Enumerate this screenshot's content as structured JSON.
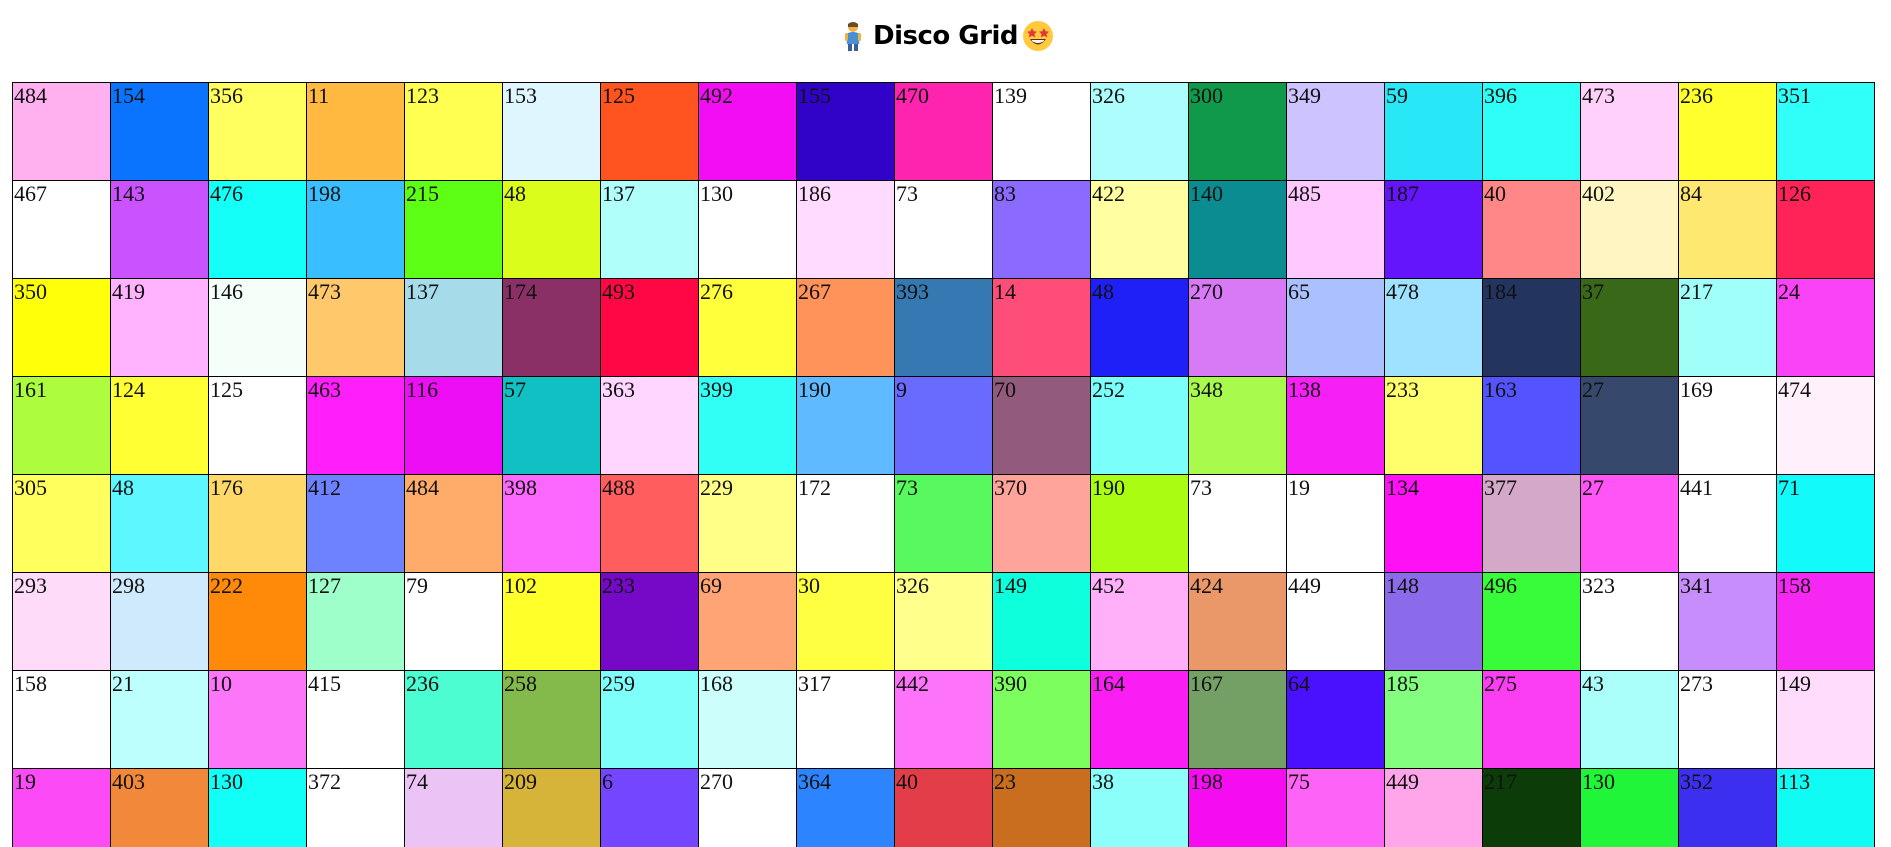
{
  "page": {
    "title": "Disco Grid",
    "left_icon": "dancing-person-icon",
    "right_icon": "star-struck-face-icon"
  },
  "grid": {
    "columns": 19,
    "rows": [
      [
        {
          "value": "484",
          "color": "#ffb0ee"
        },
        {
          "value": "154",
          "color": "#0a74ff"
        },
        {
          "value": "356",
          "color": "#ffff60"
        },
        {
          "value": "11",
          "color": "#ffb941"
        },
        {
          "value": "123",
          "color": "#ffff52"
        },
        {
          "value": "153",
          "color": "#e0f6ff"
        },
        {
          "value": "125",
          "color": "#ff5420"
        },
        {
          "value": "492",
          "color": "#f20df3"
        },
        {
          "value": "155",
          "color": "#3103c8"
        },
        {
          "value": "470",
          "color": "#ff24b0"
        },
        {
          "value": "139",
          "color": "#ffffff"
        },
        {
          "value": "326",
          "color": "#adfdfc"
        },
        {
          "value": "300",
          "color": "#10994a"
        },
        {
          "value": "349",
          "color": "#ccc3ff"
        },
        {
          "value": "59",
          "color": "#28e8f8"
        },
        {
          "value": "396",
          "color": "#2efff6"
        },
        {
          "value": "473",
          "color": "#ffd1fa"
        },
        {
          "value": "236",
          "color": "#ffff2e"
        },
        {
          "value": "351",
          "color": "#30fff9"
        }
      ],
      [
        {
          "value": "467",
          "color": "#ffffff"
        },
        {
          "value": "143",
          "color": "#cb53ff"
        },
        {
          "value": "476",
          "color": "#13fff8"
        },
        {
          "value": "198",
          "color": "#39beff"
        },
        {
          "value": "215",
          "color": "#5dff15"
        },
        {
          "value": "48",
          "color": "#dbfd1b"
        },
        {
          "value": "137",
          "color": "#b0fffa"
        },
        {
          "value": "130",
          "color": "#ffffff"
        },
        {
          "value": "186",
          "color": "#ffdbff"
        },
        {
          "value": "73",
          "color": "#ffffff"
        },
        {
          "value": "83",
          "color": "#8b6bff"
        },
        {
          "value": "422",
          "color": "#ffffa2"
        },
        {
          "value": "140",
          "color": "#0b8c91"
        },
        {
          "value": "485",
          "color": "#ffc8ff"
        },
        {
          "value": "187",
          "color": "#6515fb"
        },
        {
          "value": "40",
          "color": "#ff8787"
        },
        {
          "value": "402",
          "color": "#fff5c2"
        },
        {
          "value": "84",
          "color": "#ffe870"
        },
        {
          "value": "126",
          "color": "#ff2358"
        }
      ],
      [
        {
          "value": "350",
          "color": "#ffff0a"
        },
        {
          "value": "419",
          "color": "#ffb3ff"
        },
        {
          "value": "146",
          "color": "#f5fffa"
        },
        {
          "value": "473",
          "color": "#ffc96b"
        },
        {
          "value": "137",
          "color": "#a6dcea"
        },
        {
          "value": "174",
          "color": "#8b3066"
        },
        {
          "value": "493",
          "color": "#ff0745"
        },
        {
          "value": "276",
          "color": "#ffff3c"
        },
        {
          "value": "267",
          "color": "#ff9359"
        },
        {
          "value": "393",
          "color": "#3678b2"
        },
        {
          "value": "14",
          "color": "#ff4d79"
        },
        {
          "value": "48",
          "color": "#1f1ff7"
        },
        {
          "value": "270",
          "color": "#d879f5"
        },
        {
          "value": "65",
          "color": "#abc1ff"
        },
        {
          "value": "478",
          "color": "#9ee2ff"
        },
        {
          "value": "184",
          "color": "#23345e"
        },
        {
          "value": "37",
          "color": "#386818"
        },
        {
          "value": "217",
          "color": "#a1fffa"
        },
        {
          "value": "24",
          "color": "#fa42f7"
        }
      ],
      [
        {
          "value": "161",
          "color": "#adfc3d"
        },
        {
          "value": "124",
          "color": "#ffff33"
        },
        {
          "value": "125",
          "color": "#ffffff"
        },
        {
          "value": "463",
          "color": "#ff1ffb"
        },
        {
          "value": "116",
          "color": "#ee0ef6"
        },
        {
          "value": "57",
          "color": "#11c0c2"
        },
        {
          "value": "363",
          "color": "#ffd6ff"
        },
        {
          "value": "399",
          "color": "#31fff5"
        },
        {
          "value": "190",
          "color": "#5fbaff"
        },
        {
          "value": "9",
          "color": "#696bff"
        },
        {
          "value": "70",
          "color": "#925a7c"
        },
        {
          "value": "252",
          "color": "#7bfffa"
        },
        {
          "value": "348",
          "color": "#a8fa4d"
        },
        {
          "value": "138",
          "color": "#f61ff6"
        },
        {
          "value": "233",
          "color": "#ffff6b"
        },
        {
          "value": "163",
          "color": "#5454ff"
        },
        {
          "value": "27",
          "color": "#37486d"
        },
        {
          "value": "169",
          "color": "#ffffff"
        },
        {
          "value": "474",
          "color": "#fff0fb"
        }
      ],
      [
        {
          "value": "305",
          "color": "#ffff5e"
        },
        {
          "value": "48",
          "color": "#5cf7ff"
        },
        {
          "value": "176",
          "color": "#ffd86a"
        },
        {
          "value": "412",
          "color": "#6e82ff"
        },
        {
          "value": "484",
          "color": "#ffab6a"
        },
        {
          "value": "398",
          "color": "#fc67fe"
        },
        {
          "value": "488",
          "color": "#ff5d5e"
        },
        {
          "value": "229",
          "color": "#ffff88"
        },
        {
          "value": "172",
          "color": "#ffffff"
        },
        {
          "value": "73",
          "color": "#57f95f"
        },
        {
          "value": "370",
          "color": "#ffa49a"
        },
        {
          "value": "190",
          "color": "#aafd12"
        },
        {
          "value": "73",
          "color": "#ffffff"
        },
        {
          "value": "19",
          "color": "#ffffff"
        },
        {
          "value": "134",
          "color": "#ff10f5"
        },
        {
          "value": "377",
          "color": "#d3a8c8"
        },
        {
          "value": "27",
          "color": "#ff54f6"
        },
        {
          "value": "441",
          "color": "#ffffff"
        },
        {
          "value": "71",
          "color": "#12fbfa"
        }
      ],
      [
        {
          "value": "293",
          "color": "#ffdbfa"
        },
        {
          "value": "298",
          "color": "#cfe9fd"
        },
        {
          "value": "222",
          "color": "#ff8a0a"
        },
        {
          "value": "127",
          "color": "#9effcb"
        },
        {
          "value": "79",
          "color": "#ffffff"
        },
        {
          "value": "102",
          "color": "#ffff2a"
        },
        {
          "value": "233",
          "color": "#7608c8"
        },
        {
          "value": "69",
          "color": "#ffa475"
        },
        {
          "value": "30",
          "color": "#ffff41"
        },
        {
          "value": "326",
          "color": "#ffff8c"
        },
        {
          "value": "149",
          "color": "#0effdb"
        },
        {
          "value": "452",
          "color": "#ffb0f9"
        },
        {
          "value": "424",
          "color": "#ea9769"
        },
        {
          "value": "449",
          "color": "#ffffff"
        },
        {
          "value": "148",
          "color": "#8b6bea"
        },
        {
          "value": "496",
          "color": "#38fc3a"
        },
        {
          "value": "323",
          "color": "#ffffff"
        },
        {
          "value": "341",
          "color": "#c78dfc"
        },
        {
          "value": "158",
          "color": "#f727f3"
        }
      ],
      [
        {
          "value": "158",
          "color": "#ffffff"
        },
        {
          "value": "21",
          "color": "#bcfffc"
        },
        {
          "value": "10",
          "color": "#fb76f8"
        },
        {
          "value": "415",
          "color": "#ffffff"
        },
        {
          "value": "236",
          "color": "#4bfdd0"
        },
        {
          "value": "258",
          "color": "#84ba4c"
        },
        {
          "value": "259",
          "color": "#7efffa"
        },
        {
          "value": "168",
          "color": "#ccfffb"
        },
        {
          "value": "317",
          "color": "#ffffff"
        },
        {
          "value": "442",
          "color": "#fd73fa"
        },
        {
          "value": "390",
          "color": "#7bfe5e"
        },
        {
          "value": "164",
          "color": "#fa1ef4"
        },
        {
          "value": "167",
          "color": "#74a066"
        },
        {
          "value": "64",
          "color": "#4911ff"
        },
        {
          "value": "185",
          "color": "#84fe7e"
        },
        {
          "value": "275",
          "color": "#fb3ef2"
        },
        {
          "value": "43",
          "color": "#aafffa"
        },
        {
          "value": "273",
          "color": "#ffffff"
        },
        {
          "value": "149",
          "color": "#ffdcfb"
        }
      ],
      [
        {
          "value": "19",
          "color": "#fc4af6"
        },
        {
          "value": "403",
          "color": "#f2893a"
        },
        {
          "value": "130",
          "color": "#12fff8"
        },
        {
          "value": "372",
          "color": "#ffffff"
        },
        {
          "value": "74",
          "color": "#ebc3f4"
        },
        {
          "value": "209",
          "color": "#d6b43a"
        },
        {
          "value": "6",
          "color": "#7546ff"
        },
        {
          "value": "270",
          "color": "#ffffff"
        },
        {
          "value": "364",
          "color": "#2c84ff"
        },
        {
          "value": "40",
          "color": "#e33d4a"
        },
        {
          "value": "23",
          "color": "#c96d1e"
        },
        {
          "value": "38",
          "color": "#8cfffb"
        },
        {
          "value": "198",
          "color": "#f50cf0"
        },
        {
          "value": "75",
          "color": "#fd63f6"
        },
        {
          "value": "449",
          "color": "#ffa6ea"
        },
        {
          "value": "217",
          "color": "#0c3d08"
        },
        {
          "value": "130",
          "color": "#20f53a"
        },
        {
          "value": "352",
          "color": "#3c2ff0"
        },
        {
          "value": "113",
          "color": "#10fbf4"
        }
      ]
    ]
  }
}
